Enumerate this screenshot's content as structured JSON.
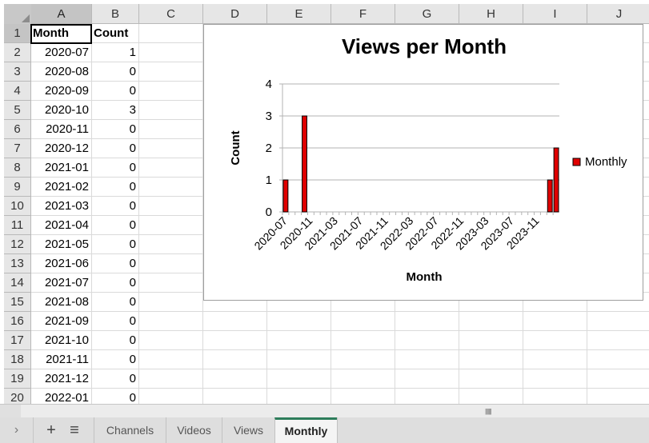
{
  "columns": [
    "A",
    "B",
    "C",
    "D",
    "E",
    "F",
    "G",
    "H",
    "I",
    "J"
  ],
  "selected_column": "A",
  "selected_row": 1,
  "rows": [
    {
      "num": "1",
      "month": "Month",
      "count": "Count",
      "header": true
    },
    {
      "num": "2",
      "month": "2020-07",
      "count": "1"
    },
    {
      "num": "3",
      "month": "2020-08",
      "count": "0"
    },
    {
      "num": "4",
      "month": "2020-09",
      "count": "0"
    },
    {
      "num": "5",
      "month": "2020-10",
      "count": "3"
    },
    {
      "num": "6",
      "month": "2020-11",
      "count": "0"
    },
    {
      "num": "7",
      "month": "2020-12",
      "count": "0"
    },
    {
      "num": "8",
      "month": "2021-01",
      "count": "0"
    },
    {
      "num": "9",
      "month": "2021-02",
      "count": "0"
    },
    {
      "num": "10",
      "month": "2021-03",
      "count": "0"
    },
    {
      "num": "11",
      "month": "2021-04",
      "count": "0"
    },
    {
      "num": "12",
      "month": "2021-05",
      "count": "0"
    },
    {
      "num": "13",
      "month": "2021-06",
      "count": "0"
    },
    {
      "num": "14",
      "month": "2021-07",
      "count": "0"
    },
    {
      "num": "15",
      "month": "2021-08",
      "count": "0"
    },
    {
      "num": "16",
      "month": "2021-09",
      "count": "0"
    },
    {
      "num": "17",
      "month": "2021-10",
      "count": "0"
    },
    {
      "num": "18",
      "month": "2021-11",
      "count": "0"
    },
    {
      "num": "19",
      "month": "2021-12",
      "count": "0"
    },
    {
      "num": "20",
      "month": "2022-01",
      "count": "0"
    }
  ],
  "sheet_tabs": [
    {
      "label": "Channels",
      "active": false
    },
    {
      "label": "Videos",
      "active": false
    },
    {
      "label": "Views",
      "active": false
    },
    {
      "label": "Monthly",
      "active": true
    }
  ],
  "tab_controls": {
    "nav_icon": "chevron-right-icon",
    "add_icon": "plus-icon",
    "list_icon": "sheet-list-icon",
    "nav_glyph": "›",
    "add_glyph": "+",
    "list_glyph": "≡"
  },
  "chart_data": {
    "type": "bar",
    "title": "Views per Month",
    "xlabel": "Month",
    "ylabel": "Count",
    "ylim": [
      0,
      4
    ],
    "yticks": [
      "0",
      "1",
      "2",
      "3",
      "4"
    ],
    "grid": true,
    "legend_position": "right",
    "series": [
      {
        "name": "Monthly",
        "color": "#e00000"
      }
    ],
    "categories": [
      "2020-07",
      "2020-08",
      "2020-09",
      "2020-10",
      "2020-11",
      "2020-12",
      "2021-01",
      "2021-02",
      "2021-03",
      "2021-04",
      "2021-05",
      "2021-06",
      "2021-07",
      "2021-08",
      "2021-09",
      "2021-10",
      "2021-11",
      "2021-12",
      "2022-01",
      "2022-02",
      "2022-03",
      "2022-04",
      "2022-05",
      "2022-06",
      "2022-07",
      "2022-08",
      "2022-09",
      "2022-10",
      "2022-11",
      "2022-12",
      "2023-01",
      "2023-02",
      "2023-03",
      "2023-04",
      "2023-05",
      "2023-06",
      "2023-07",
      "2023-08",
      "2023-09",
      "2023-10",
      "2023-11",
      "2023-12",
      "2024-01",
      "2024-02"
    ],
    "values": [
      1,
      0,
      0,
      3,
      0,
      0,
      0,
      0,
      0,
      0,
      0,
      0,
      0,
      0,
      0,
      0,
      0,
      0,
      0,
      0,
      0,
      0,
      0,
      0,
      0,
      0,
      0,
      0,
      0,
      0,
      0,
      0,
      0,
      0,
      0,
      0,
      0,
      0,
      0,
      0,
      0,
      0,
      1,
      2
    ],
    "xtick_labels": [
      "2020-07",
      "2020-11",
      "2021-03",
      "2021-07",
      "2021-11",
      "2022-03",
      "2022-07",
      "2022-11",
      "2023-03",
      "2023-07",
      "2023-11"
    ]
  }
}
